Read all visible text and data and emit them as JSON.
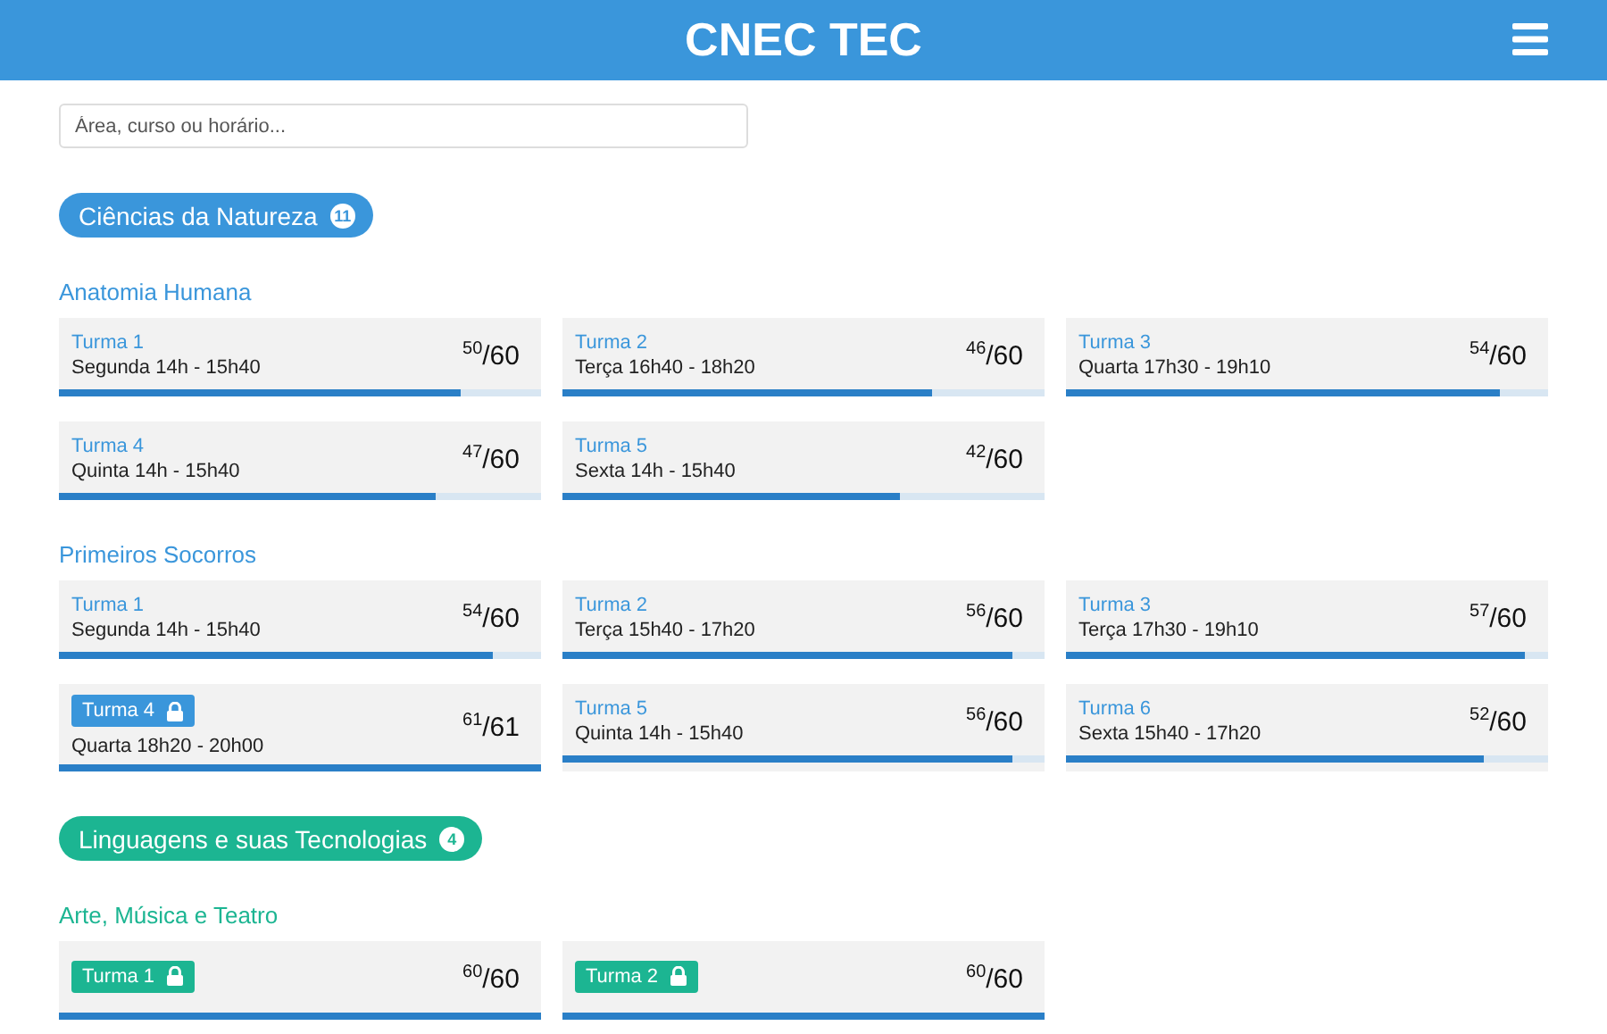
{
  "header": {
    "title": "CNEC TEC"
  },
  "search": {
    "placeholder": "Área, curso ou horário..."
  },
  "areas": [
    {
      "name": "Ciências da Natureza",
      "count": "11",
      "color": "#3a96db",
      "courses": [
        {
          "name": "Anatomia Humana",
          "classes": [
            {
              "label": "Turma 1",
              "schedule": "Segunda 14h - 15h40",
              "count": "$^{50}$/60",
              "level": 0.833,
              "locked": false
            },
            {
              "label": "Turma 2",
              "schedule": "Terça 16h40 - 18h20",
              "count": "$^{46}$/60",
              "level": 0.767,
              "locked": false
            },
            {
              "label": "Turma 3",
              "schedule": "Quarta 17h30 - 19h10",
              "count": "$^{54}$/60",
              "level": 0.9,
              "locked": false
            },
            {
              "label": "Turma 4",
              "schedule": "Quinta 14h - 15h40",
              "count": "$^{47}$/60",
              "level": 0.783,
              "locked": false
            },
            {
              "label": "Turma 5",
              "schedule": "Sexta 14h - 15h40",
              "count": "$^{42}$/60",
              "level": 0.7,
              "locked": false
            }
          ]
        },
        {
          "name": "Primeiros Socorros",
          "classes": [
            {
              "label": "Turma 1",
              "schedule": "Segunda 14h - 15h40",
              "count": "$^{54}$/60",
              "level": 0.9,
              "locked": false
            },
            {
              "label": "Turma 2",
              "schedule": "Terça 15h40 - 17h20",
              "count": "$^{56}$/60",
              "level": 0.933,
              "locked": false
            },
            {
              "label": "Turma 3",
              "schedule": "Terça 17h30 - 19h10",
              "count": "$^{57}$/60",
              "level": 0.95,
              "locked": false
            },
            {
              "label": "Turma 4",
              "schedule": "Quarta 18h20 - 20h00",
              "count": "$^{61}$/61",
              "level": 1,
              "locked": true
            },
            {
              "label": "Turma 5",
              "schedule": "Quinta 14h - 15h40",
              "count": "$^{56}$/60",
              "level": 0.933,
              "locked": false
            },
            {
              "label": "Turma 6",
              "schedule": "Sexta 15h40 - 17h20",
              "count": "$^{52}$/60",
              "level": 0.867,
              "locked": false
            }
          ]
        }
      ]
    },
    {
      "name": "Linguagens e suas Tecnologias",
      "count": "4",
      "color": "#1cb592",
      "courses": [
        {
          "name": "Arte, Música e Teatro",
          "classes": [
            {
              "label": "Turma 1",
              "count": "$^{60}$/60",
              "level": 1,
              "locked": true
            },
            {
              "label": "Turma 2",
              "count": "$^{60}$/60",
              "level": 1,
              "locked": true
            }
          ]
        }
      ]
    }
  ]
}
